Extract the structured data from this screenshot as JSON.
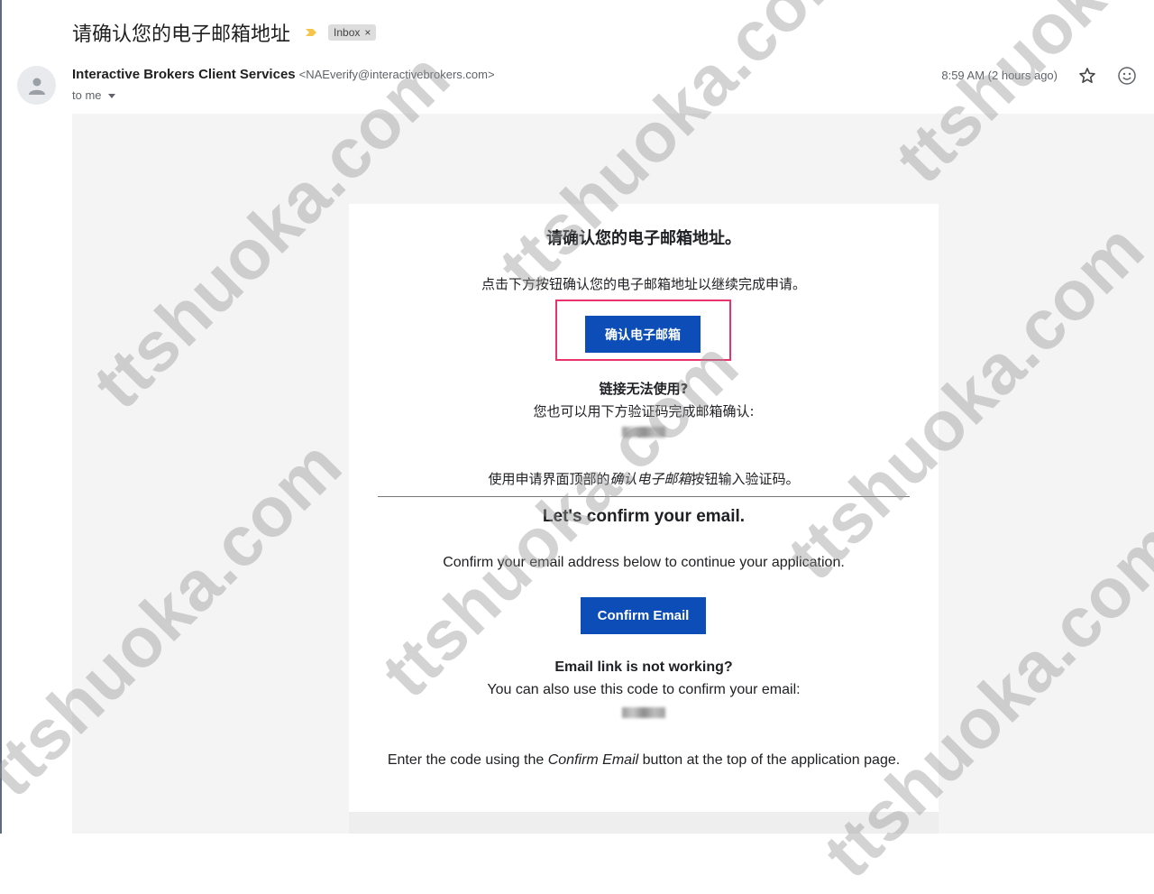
{
  "header": {
    "subject": "请确认您的电子邮箱地址",
    "label": "Inbox",
    "label_close": "×"
  },
  "sender": {
    "name": "Interactive Brokers Client Services",
    "email": "<NAEverify@interactivebrokers.com>",
    "to": "to me",
    "time": "8:59 AM (2 hours ago)"
  },
  "body_zh": {
    "heading": "请确认您的电子邮箱地址。",
    "intro": "点击下方按钮确认您的电子邮箱地址以继续完成申请。",
    "button": "确认电子邮箱",
    "question": "链接无法使用?",
    "alt": "您也可以用下方验证码完成邮箱确认:",
    "enter_prefix": "使用申请界面顶部的",
    "enter_italic": "确认电子邮箱",
    "enter_suffix": "按钮输入验证码。"
  },
  "body_en": {
    "heading": "Let's confirm your email.",
    "intro": "Confirm your email address below to continue your application.",
    "button": "Confirm Email",
    "question": "Email link is not working?",
    "alt": "You can also use this code to confirm your email:",
    "enter_prefix": "Enter the code using the ",
    "enter_italic": "Confirm Email",
    "enter_suffix": " button at the top of the application page."
  },
  "watermark": "ttshuoka.com",
  "colors": {
    "button": "#0d4db8",
    "highlight": "#e8336d",
    "importance": "#f4c54a"
  },
  "icons": [
    "person-icon",
    "importance-icon",
    "dropdown-icon",
    "star-icon",
    "emoji-icon"
  ]
}
